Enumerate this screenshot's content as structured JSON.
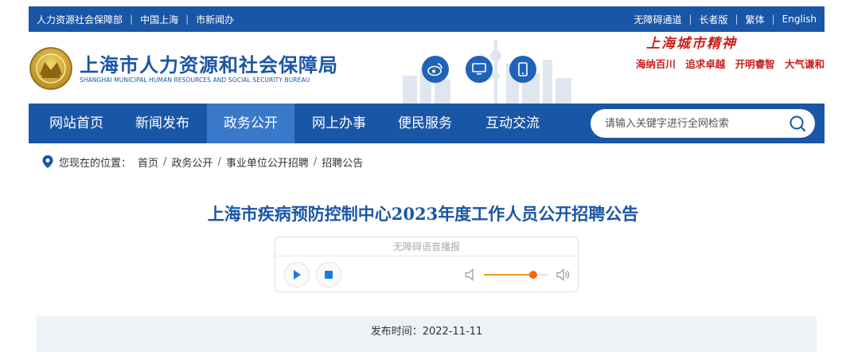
{
  "topbar": {
    "links_left": [
      "人力资源社会保障部",
      "中国上海",
      "市新闻办"
    ],
    "links_right": [
      "无障碍通道",
      "长者版",
      "繁体",
      "English"
    ]
  },
  "header": {
    "title_cn": "上海市人力资源和社会保障局",
    "title_en": "SHANGHAI MUNICIPAL HUMAN RESOURCES AND SOCIAL SECURITY BUREAU",
    "social_icons": [
      "weibo-icon",
      "monitor-icon",
      "mobile-icon"
    ],
    "spirit_title": "上海城市精神",
    "spirit_words": [
      "海纳百川",
      "追求卓越",
      "开明睿智",
      "大气谦和"
    ]
  },
  "nav": {
    "items": [
      "网站首页",
      "新闻发布",
      "政务公开",
      "网上办事",
      "便民服务",
      "互动交流"
    ],
    "active_index": 2,
    "search_placeholder": "请输入关键字进行全网检索"
  },
  "breadcrumb": {
    "label": "您现在的位置：",
    "items": [
      "首页",
      "政务公开",
      "事业单位公开招聘",
      "招聘公告"
    ]
  },
  "article": {
    "title": "上海市疾病预防控制中心2023年度工作人员公开招聘公告",
    "publish_time": "发布时间：2022-11-11"
  },
  "player": {
    "label": "无障碍语音播报",
    "volume_fraction": 0.78
  },
  "colors": {
    "brand_blue": "#1a56a6",
    "nav_active": "#3a78c9",
    "spirit_red": "#c8201c",
    "slider_orange": "#f06a13"
  }
}
